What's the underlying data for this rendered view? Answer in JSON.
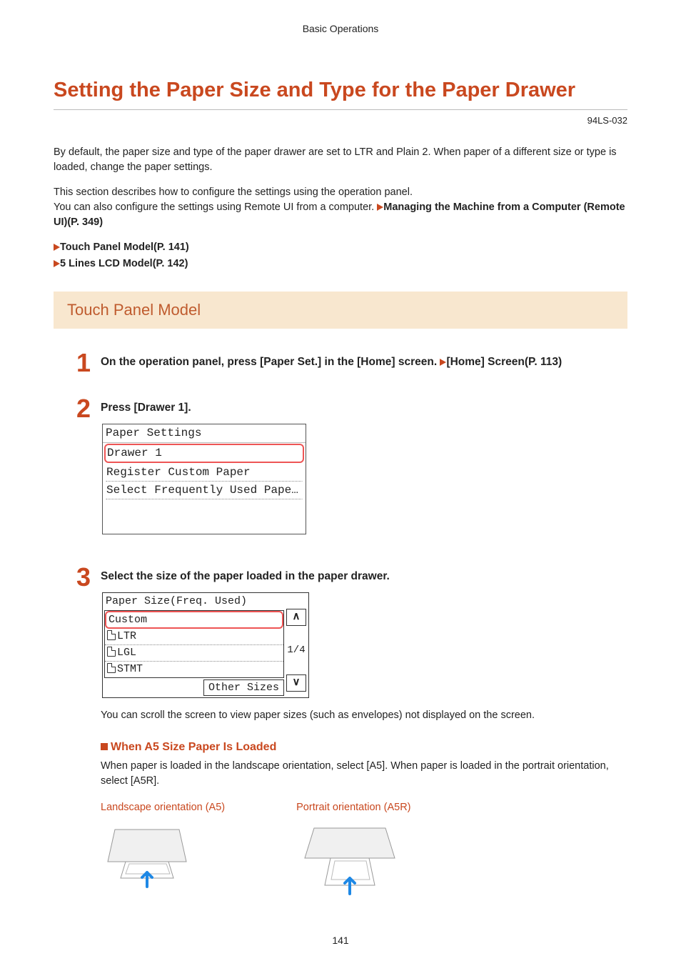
{
  "breadcrumb": "Basic Operations",
  "title": "Setting the Paper Size and Type for the Paper Drawer",
  "doc_code": "94LS-032",
  "intro": {
    "p1": "By default, the paper size and type of the paper drawer are set to LTR and Plain 2. When paper of a different size or type is loaded, change the paper settings.",
    "p2a": "This section describes how to configure the settings using the operation panel.",
    "p2b": "You can also configure the settings using Remote UI from a computer. ",
    "link1": "Managing the Machine from a Computer (Remote UI)(P. 349)"
  },
  "toc": {
    "item1": "Touch Panel Model(P. 141)",
    "item2": "5 Lines LCD Model(P. 142)"
  },
  "section_heading": "Touch Panel Model",
  "steps": {
    "s1": {
      "num": "1",
      "text_a": "On the operation panel, press [Paper Set.] in the [Home] screen. ",
      "link": "[Home] Screen(P. 113)"
    },
    "s2": {
      "num": "2",
      "text": "Press [Drawer 1].",
      "screen": {
        "title": "Paper Settings",
        "row1": "Drawer 1",
        "row2": "Register Custom Paper",
        "row3": "Select Frequently Used Pape…"
      }
    },
    "s3": {
      "num": "3",
      "text": "Select the size of the paper loaded in the paper drawer.",
      "screen": {
        "title": "Paper Size(Freq. Used)",
        "item1": "Custom",
        "item2": "LTR",
        "item3": "LGL",
        "item4": "STMT",
        "other": "Other Sizes",
        "pager": "1/4"
      },
      "note": "You can scroll the screen to view paper sizes (such as envelopes) not displayed on the screen.",
      "sub_heading": "When A5 Size Paper Is Loaded",
      "sub_body": "When paper is loaded in the landscape orientation, select [A5]. When paper is loaded in the portrait orientation, select [A5R].",
      "orient": {
        "landscape": "Landscape orientation (A5)",
        "portrait": "Portrait orientation (A5R)"
      }
    }
  },
  "page_number": "141"
}
